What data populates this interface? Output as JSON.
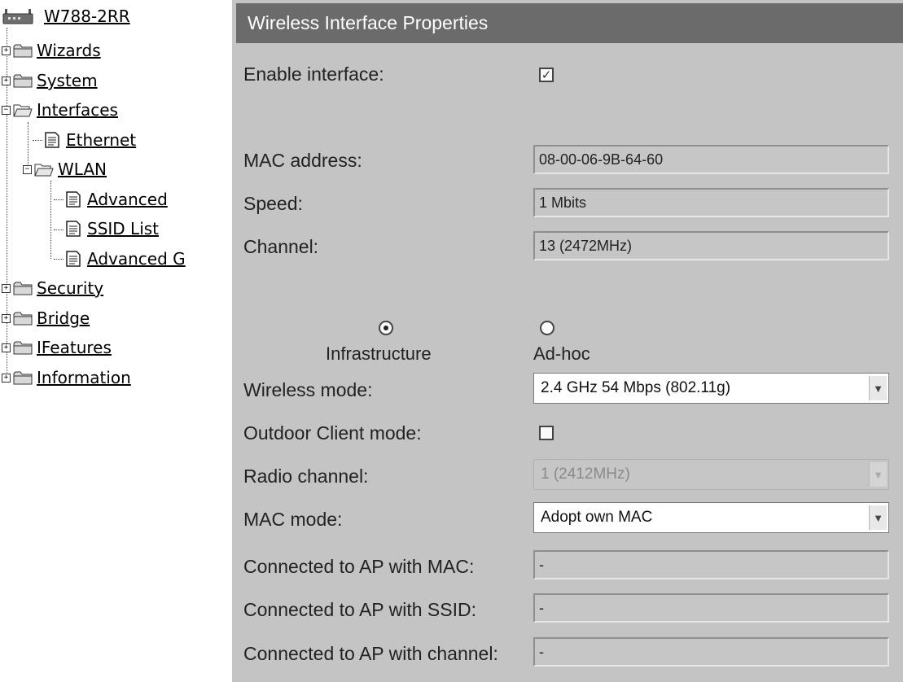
{
  "tree": {
    "device": "W788-2RR",
    "items": [
      {
        "label": "Wizards",
        "expander": "+"
      },
      {
        "label": "System",
        "expander": "+"
      },
      {
        "label": "Interfaces",
        "expander": "−"
      },
      {
        "label": "Ethernet"
      },
      {
        "label": "WLAN",
        "expander": "−"
      },
      {
        "label": "Advanced"
      },
      {
        "label": "SSID List"
      },
      {
        "label": "Advanced G"
      },
      {
        "label": "Security",
        "expander": "+"
      },
      {
        "label": "Bridge",
        "expander": "+"
      },
      {
        "label": "IFeatures",
        "expander": "+"
      },
      {
        "label": "Information",
        "expander": "+"
      }
    ]
  },
  "panel": {
    "title": "Wireless Interface Properties",
    "enable_label": "Enable interface:",
    "enable_checked": "✓",
    "mac_label": "MAC address:",
    "mac_value": "08-00-06-9B-64-60",
    "speed_label": "Speed:",
    "speed_value": "1 Mbits",
    "channel_label": "Channel:",
    "channel_value": "13 (2472MHz)",
    "radio_infrastructure": "Infrastructure",
    "radio_adhoc": "Ad-hoc",
    "wireless_mode_label": "Wireless mode:",
    "wireless_mode_value": "2.4 GHz 54 Mbps (802.11g)",
    "outdoor_label": "Outdoor Client mode:",
    "radio_channel_label": "Radio channel:",
    "radio_channel_value": "1 (2412MHz)",
    "mac_mode_label": "MAC mode:",
    "mac_mode_value": "Adopt own MAC",
    "ap_mac_label": "Connected to AP with MAC:",
    "ap_mac_value": "-",
    "ap_ssid_label": "Connected to AP with SSID:",
    "ap_ssid_value": "-",
    "ap_channel_label": "Connected to AP with channel:",
    "ap_channel_value": "-"
  },
  "colors": {
    "panel_bg": "#c4c4c4",
    "header_bg": "#6b6b6b",
    "header_text": "#ffffff"
  }
}
